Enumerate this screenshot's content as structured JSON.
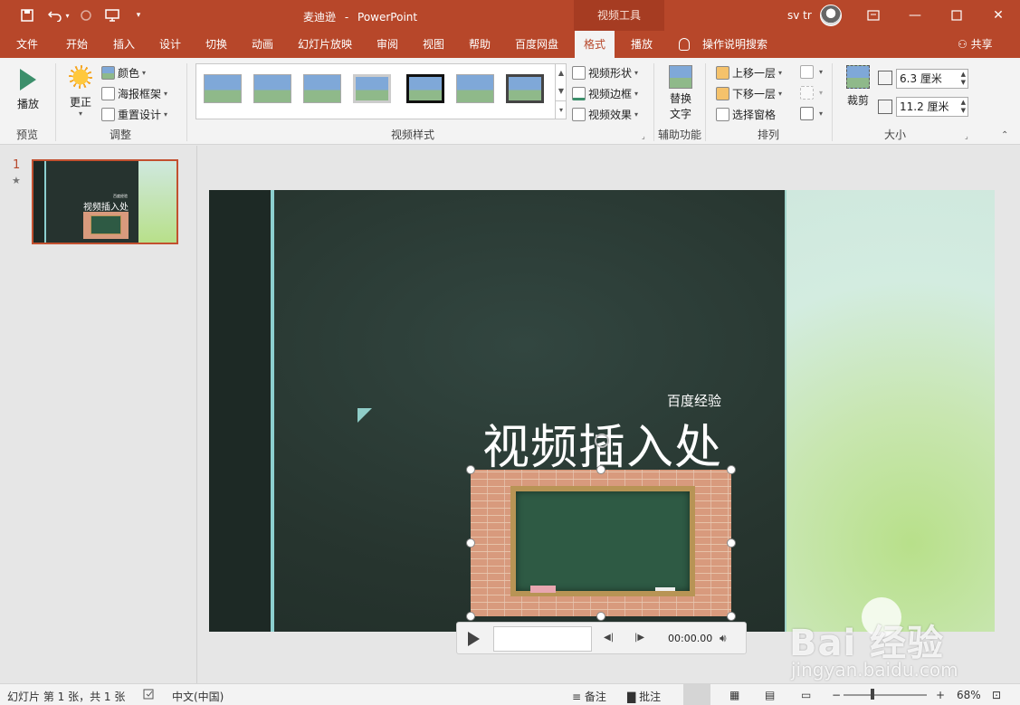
{
  "title_bar": {
    "document_name": "麦迪逊",
    "separator": "-",
    "app_name": "PowerPoint",
    "context_tab_group": "视频工具",
    "user_name": "sv tr",
    "quick_access": [
      "save-icon",
      "undo-icon",
      "redo-icon",
      "start-from-beginning-icon",
      "customize-icon"
    ]
  },
  "tabs": [
    {
      "label": "文件"
    },
    {
      "label": "开始"
    },
    {
      "label": "插入"
    },
    {
      "label": "设计"
    },
    {
      "label": "切换"
    },
    {
      "label": "动画"
    },
    {
      "label": "幻灯片放映"
    },
    {
      "label": "审阅"
    },
    {
      "label": "视图"
    },
    {
      "label": "帮助"
    },
    {
      "label": "百度网盘"
    },
    {
      "label": "格式",
      "active": true
    },
    {
      "label": "播放"
    }
  ],
  "tell_me": "操作说明搜索",
  "share": "共享",
  "ribbon": {
    "preview": {
      "button": "播放",
      "group": "预览"
    },
    "adjust": {
      "corrections": "更正",
      "color": "颜色",
      "poster_frame": "海报框架",
      "reset_design": "重置设计",
      "group": "调整"
    },
    "video_styles": {
      "shape": "视频形状",
      "border": "视频边框",
      "effects": "视频效果",
      "group": "视频样式"
    },
    "accessibility": {
      "alt_text_line1": "替换",
      "alt_text_line2": "文字",
      "group": "辅助功能"
    },
    "arrange": {
      "bring_forward": "上移一层",
      "send_backward": "下移一层",
      "selection_pane": "选择窗格",
      "group": "排列"
    },
    "size": {
      "crop": "裁剪",
      "height": "6.3 厘米",
      "width": "11.2 厘米",
      "group": "大小"
    }
  },
  "slides_panel": {
    "slide_number": "1",
    "star": "★"
  },
  "slide": {
    "subtitle": "百度经验",
    "title": "视频插入处",
    "thumb_subtitle": "百度经验",
    "thumb_title": "视频插入处"
  },
  "media": {
    "time": "00:00.00"
  },
  "status_bar": {
    "slide_info": "幻灯片 第 1 张，共 1 张",
    "language": "中文(中国)",
    "notes": "备注",
    "comments": "批注",
    "zoom": "68%"
  },
  "watermark": {
    "brand": "Bai  经验",
    "url": "jingyan.baidu.com"
  },
  "colors": {
    "accent": "#b7472a",
    "slide_bg": "#27352f",
    "teal_line": "#8ccfcf"
  }
}
